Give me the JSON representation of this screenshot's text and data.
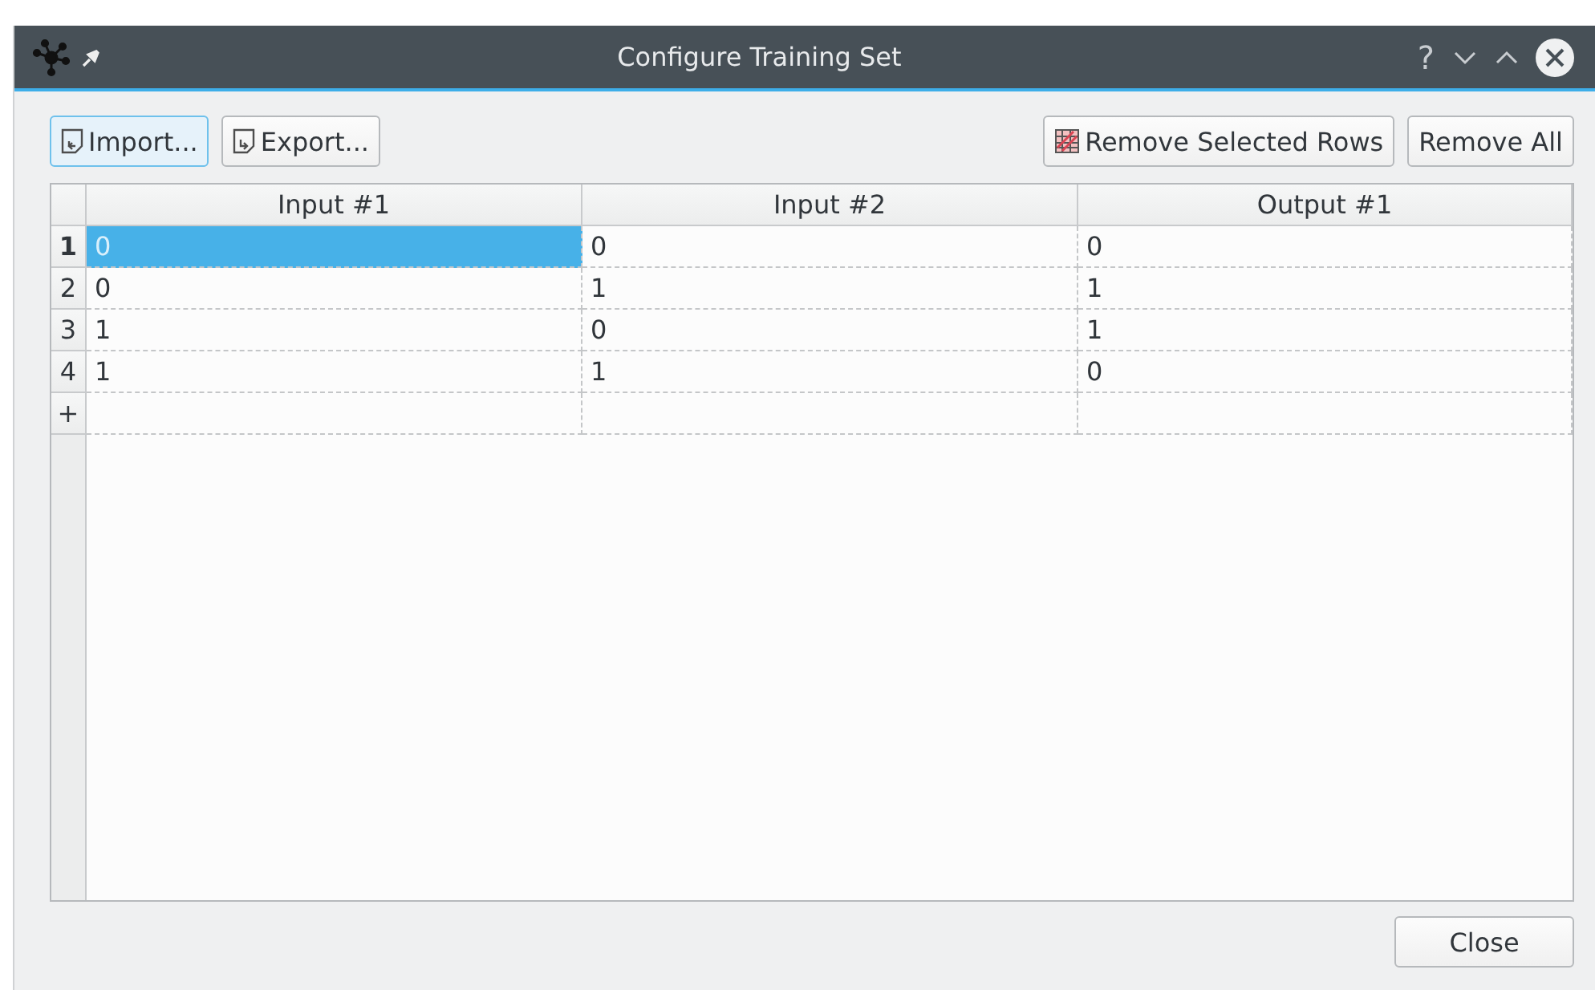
{
  "window": {
    "title": "Configure Training Set",
    "controls": [
      "?"
    ]
  },
  "toolbar": {
    "left": [
      {
        "label": "Import...",
        "kind": "import",
        "focused": true
      },
      {
        "label": "Export...",
        "kind": "export",
        "focused": false
      }
    ],
    "right": [
      {
        "label": "Remove Selected Rows",
        "kind": "remove-rows",
        "focused": false
      },
      {
        "label": "Remove All",
        "kind": "plain",
        "focused": false
      }
    ]
  },
  "table": {
    "columns": [
      "Input #1",
      "Input #2",
      "Output #1"
    ],
    "rows": [
      {
        "header": "1",
        "current": true,
        "cells": [
          {
            "text": "0",
            "selected": true
          },
          {
            "text": "0",
            "selected": false
          },
          {
            "text": "0",
            "selected": false
          }
        ]
      },
      {
        "header": "2",
        "current": false,
        "cells": [
          {
            "text": "0",
            "selected": false
          },
          {
            "text": "1",
            "selected": false
          },
          {
            "text": "1",
            "selected": false
          }
        ]
      },
      {
        "header": "3",
        "current": false,
        "cells": [
          {
            "text": "1",
            "selected": false
          },
          {
            "text": "0",
            "selected": false
          },
          {
            "text": "1",
            "selected": false
          }
        ]
      },
      {
        "header": "4",
        "current": false,
        "cells": [
          {
            "text": "1",
            "selected": false
          },
          {
            "text": "1",
            "selected": false
          },
          {
            "text": "0",
            "selected": false
          }
        ]
      }
    ],
    "new_row": {
      "header": "+"
    }
  },
  "buttons": [
    "Close"
  ]
}
